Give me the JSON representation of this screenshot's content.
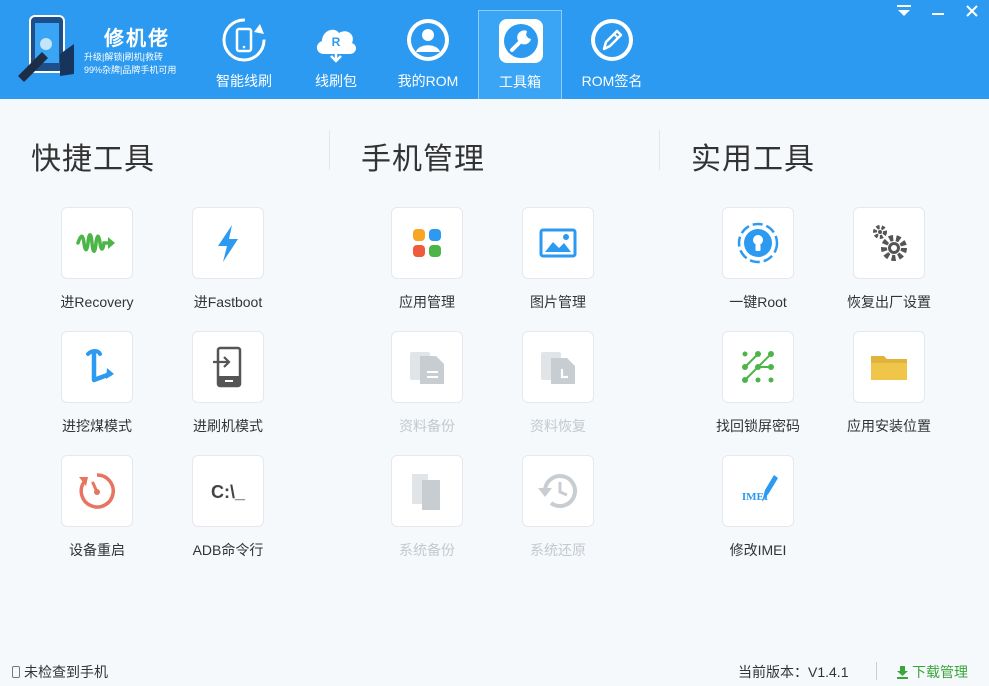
{
  "brand": {
    "name": "修机佬",
    "tagline1": "升级|解锁|刷机|救砖",
    "tagline2": "99%杂牌|品牌手机可用"
  },
  "nav": [
    {
      "label": "智能线刷",
      "icon": "phone-refresh-icon"
    },
    {
      "label": "线刷包",
      "icon": "cloud-download-icon",
      "badge": "R"
    },
    {
      "label": "我的ROM",
      "icon": "user-icon"
    },
    {
      "label": "工具箱",
      "icon": "wrench-icon",
      "active": true
    },
    {
      "label": "ROM签名",
      "icon": "pen-icon"
    }
  ],
  "sections": {
    "quick": {
      "title": "快捷工具"
    },
    "phone": {
      "title": "手机管理"
    },
    "utility": {
      "title": "实用工具"
    }
  },
  "tools": {
    "recovery": {
      "label": "进Recovery",
      "icon": "waveform-icon"
    },
    "fastboot": {
      "label": "进Fastboot",
      "icon": "lightning-icon"
    },
    "edl": {
      "label": "进挖煤模式",
      "icon": "pickaxe-icon"
    },
    "flash_mode": {
      "label": "进刷机模式",
      "icon": "phone-enter-icon"
    },
    "reboot": {
      "label": "设备重启",
      "icon": "restart-icon"
    },
    "adb": {
      "label": "ADB命令行",
      "icon": "terminal-icon",
      "glyph": "C:\\_"
    },
    "app_manage": {
      "label": "应用管理",
      "icon": "apps-grid-icon"
    },
    "image_manage": {
      "label": "图片管理",
      "icon": "image-icon"
    },
    "data_backup": {
      "label": "资料备份",
      "icon": "document-backup-icon",
      "disabled": true
    },
    "data_restore": {
      "label": "资料恢复",
      "icon": "document-restore-icon",
      "disabled": true
    },
    "system_backup": {
      "label": "系统备份",
      "icon": "copy-icon",
      "disabled": true
    },
    "system_restore": {
      "label": "系统还原",
      "icon": "history-icon",
      "disabled": true
    },
    "root": {
      "label": "一键Root",
      "icon": "root-bulb-icon"
    },
    "factory_reset": {
      "label": "恢复出厂设置",
      "icon": "gears-icon"
    },
    "unlock_pattern": {
      "label": "找回锁屏密码",
      "icon": "pattern-lock-icon"
    },
    "install_location": {
      "label": "应用安装位置",
      "icon": "folder-icon"
    },
    "imei": {
      "label": "修改IMEI",
      "icon": "imei-edit-icon",
      "glyph": "IMEI"
    }
  },
  "status": {
    "device": "未检查到手机",
    "version": "当前版本：V1.4.1",
    "download": "下载管理"
  },
  "colors": {
    "header": "#2c9af0",
    "accent_green": "#3aa53a",
    "icon_blue": "#2c9af0",
    "disabled": "#c4c9ce"
  }
}
